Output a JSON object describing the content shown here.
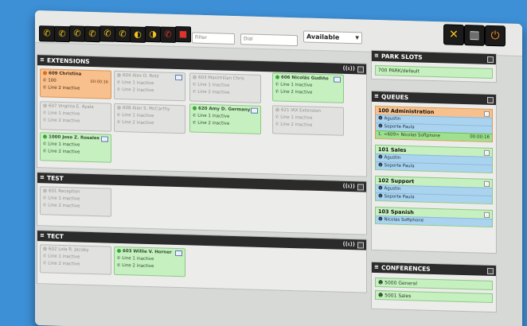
{
  "toolbar": {
    "buttons": [
      {
        "icon": "phone-icon",
        "glyph": "✆"
      },
      {
        "icon": "phone-transfer-icon",
        "glyph": "✆"
      },
      {
        "icon": "phone-forward-icon",
        "glyph": "✆"
      },
      {
        "icon": "phone-conference-icon",
        "glyph": "✆"
      },
      {
        "icon": "phone-voicemail-icon",
        "glyph": "✆"
      },
      {
        "icon": "phone-pickup-icon",
        "glyph": "✆"
      },
      {
        "icon": "ear-icon",
        "glyph": "◐"
      },
      {
        "icon": "ear-whisper-icon",
        "glyph": "◑"
      },
      {
        "icon": "hangup-icon",
        "glyph": "✆"
      },
      {
        "icon": "record-icon",
        "glyph": "■"
      }
    ],
    "filter_placeholder": "Filter",
    "dial_placeholder": "Dial",
    "status_value": "Available",
    "tools_icon": "tools-icon",
    "book_icon": "book-icon",
    "power_icon": "power-icon"
  },
  "extensions": {
    "title": "EXTENSIONS",
    "items": [
      {
        "name": "609 Christina",
        "line1": "100",
        "line2": "Line 2 inactive",
        "timer": "00:00:16",
        "state": "orange"
      },
      {
        "name": "604 Alex D. Rotz",
        "line1": "Line 1 inactive",
        "line2": "Line 2 inactive",
        "state": "grey"
      },
      {
        "name": "603 Maximilian Chris",
        "line1": "Line 1 inactive",
        "line2": "Line 2 inactive",
        "state": "grey"
      },
      {
        "name": "606 Nicolás Gudiño",
        "line1": "Line 1 inactive",
        "line2": "Line 2 inactive",
        "state": "green"
      },
      {
        "name": "607 Virginia E. Ayala",
        "line1": "Line 1 inactive",
        "line2": "Line 2 inactive",
        "state": "grey"
      },
      {
        "name": "608 Alan S. McCarthy",
        "line1": "Line 1 inactive",
        "line2": "Line 2 inactive",
        "state": "grey"
      },
      {
        "name": "620 Amy D. Germany",
        "line1": "Line 1 inactive",
        "line2": "Line 2 inactive",
        "state": "green"
      },
      {
        "name": "621 IAX Extension",
        "line1": "Line 1 inactive",
        "line2": "Line 2 inactive",
        "state": "grey"
      },
      {
        "name": "1000 Jose Z. Rosales",
        "line1": "Line 1 inactive",
        "line2": "Line 2 inactive",
        "state": "green"
      }
    ]
  },
  "test": {
    "title": "TEST",
    "items": [
      {
        "name": "601 Reception",
        "line1": "Line 1 inactive",
        "line2": "Line 2 inactive",
        "state": "grey"
      }
    ]
  },
  "tect": {
    "title": "TECT",
    "items": [
      {
        "name": "602 Lola R. Jacoby",
        "line1": "Line 1 inactive",
        "line2": "Line 2 inactive",
        "state": "grey"
      },
      {
        "name": "603 Willie V. Horner",
        "line1": "Line 1 inactive",
        "line2": "Line 2 inactive",
        "state": "green"
      }
    ]
  },
  "park": {
    "title": "PARK SLOTS",
    "slots": [
      "700 PARK/default"
    ]
  },
  "queues": {
    "title": "QUEUES",
    "items": [
      {
        "name": "100 Administration",
        "members": [
          "Agustin",
          "Soporte Paula"
        ],
        "waiting": "1. <609> Nicolas Softphone",
        "wait_time": "00:00:16",
        "state": "orange"
      },
      {
        "name": "101 Sales",
        "members": [
          "Agustin",
          "Soporte Paula"
        ],
        "state": "green"
      },
      {
        "name": "102 Support",
        "members": [
          "Agustin",
          "Soporte Paula"
        ],
        "state": "green"
      },
      {
        "name": "103 Spanish",
        "members": [
          "Nicolas Softphone"
        ],
        "state": "green"
      }
    ]
  },
  "conferences": {
    "title": "CONFERENCES",
    "rooms": [
      "5000 General",
      "5001 Sales"
    ]
  }
}
